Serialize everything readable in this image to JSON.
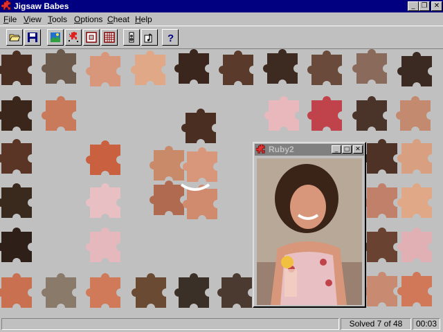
{
  "window": {
    "title": "Jigsaw Babes",
    "minimize_icon": "minimize-icon",
    "restore_icon": "restore-icon",
    "close_icon": "close-icon",
    "minimize_glyph": "_",
    "restore_glyph": "❐",
    "close_glyph": "✕"
  },
  "menu": {
    "items": [
      {
        "label": "File",
        "accel": "F",
        "rest": "ile"
      },
      {
        "label": "View",
        "accel": "V",
        "rest": "iew"
      },
      {
        "label": "Tools",
        "accel": "T",
        "rest": "ools"
      },
      {
        "label": "Options",
        "accel": "O",
        "rest": "ptions"
      },
      {
        "label": "Cheat",
        "accel": "C",
        "rest": "heat"
      },
      {
        "label": "Help",
        "accel": "H",
        "rest": "elp"
      }
    ]
  },
  "toolbar": {
    "buttons": [
      {
        "name": "open-folder-icon"
      },
      {
        "name": "save-disk-icon"
      },
      {
        "name": "picture-icon"
      },
      {
        "name": "scatter-pieces-icon"
      },
      {
        "name": "small-grid-icon"
      },
      {
        "name": "large-grid-icon"
      },
      {
        "name": "sound-speaker-icon"
      },
      {
        "name": "music-icon"
      },
      {
        "name": "help-question-icon"
      }
    ],
    "help_glyph": "?"
  },
  "preview": {
    "title": "Ruby2",
    "minimize_glyph": "_",
    "maximize_glyph": "□",
    "close_glyph": "✕"
  },
  "status": {
    "message": "",
    "solved_text": "Solved 7 of 48",
    "timer": "00:03"
  },
  "colors": {
    "title_active": "#000080",
    "title_inactive": "#808080",
    "face": "#c0c0c0",
    "skin": "#d8977a",
    "skin_dark": "#b06a50",
    "hair": "#4a2e22",
    "hair_dark": "#2a1a12",
    "dress_pink": "#e8c0c4",
    "flower_red": "#c0424a",
    "drink_yellow": "#f2c040"
  }
}
